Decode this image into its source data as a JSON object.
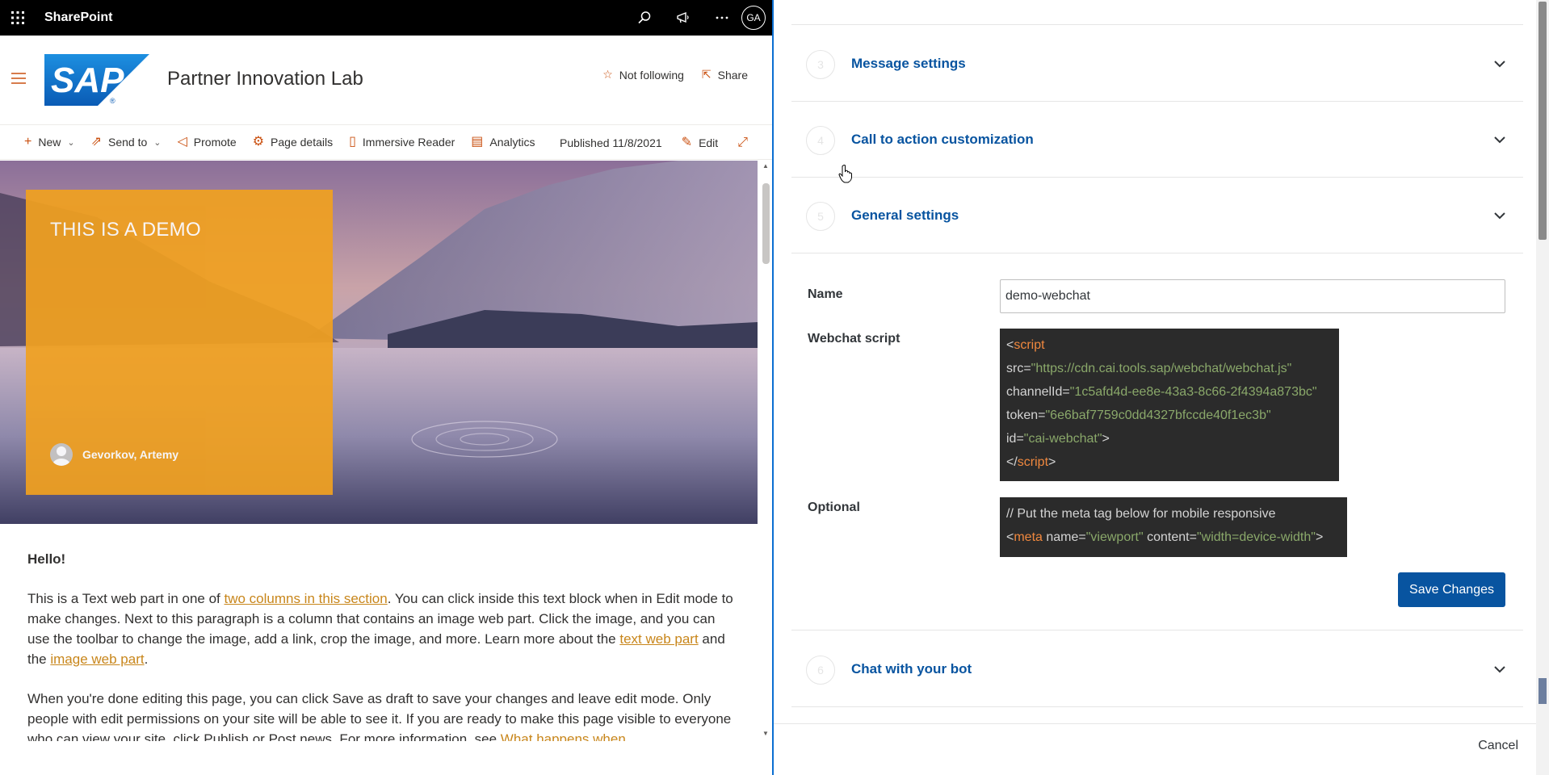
{
  "suitebar": {
    "app_name": "SharePoint",
    "user_initials": "GA"
  },
  "site": {
    "title": "Partner Innovation Lab",
    "follow_label": "Not following",
    "share_label": "Share"
  },
  "commandbar": {
    "new": "New",
    "send_to": "Send to",
    "promote": "Promote",
    "page_details": "Page details",
    "immersive_reader": "Immersive Reader",
    "analytics": "Analytics",
    "published": "Published 11/8/2021",
    "edit": "Edit"
  },
  "hero": {
    "title": "THIS IS A DEMO",
    "author": "Gevorkov, Artemy"
  },
  "article": {
    "heading": "Hello!",
    "p1_a": "This is a Text web part in one of ",
    "p1_link1": "two columns in this section",
    "p1_b": ". You can click inside this text block when in Edit mode to make changes. Next to this paragraph is a column that contains an image web part. Click the image, and you can use the toolbar to change the image, add a link, crop the image, and more. Learn more about the ",
    "p1_link2": "text web part",
    "p1_c": " and the ",
    "p1_link3": "image web part",
    "p1_d": ".",
    "p2_a": "When you're done editing this page, you can click Save as draft to save your changes and leave edit mode. Only people with edit permissions on your site will be able to see it. If you are ready to make this page visible to everyone who can view your site, click Publish or Post news. For more information, see ",
    "p2_link": "What happens when"
  },
  "panel": {
    "steps": [
      {
        "number": "3",
        "label": "Message settings"
      },
      {
        "number": "4",
        "label": "Call to action customization"
      },
      {
        "number": "5",
        "label": "General settings"
      },
      {
        "number": "6",
        "label": "Chat with your bot"
      }
    ],
    "form": {
      "name_label": "Name",
      "name_value": "demo-webchat",
      "script_label": "Webchat script",
      "script": {
        "open_lt": "<",
        "open_tag": "script",
        "src_attr": "src=",
        "src_val": "\"https://cdn.cai.tools.sap/webchat/webchat.js\"",
        "channel_attr": "channelId=",
        "channel_val": "\"1c5afd4d-ee8e-43a3-8c66-2f4394a873bc\"",
        "token_attr": "token=",
        "token_val": "\"6e6baf7759c0dd4327bfccde40f1ec3b\"",
        "id_attr": "id=",
        "id_val": "\"cai-webchat\"",
        "gt": ">",
        "close_lt": "</",
        "close_tag": "script",
        "close_gt": ">"
      },
      "optional_label": "Optional",
      "optional": {
        "comment": "// Put the meta tag below for mobile responsive",
        "lt": "<",
        "tag": "meta",
        "name_attr": " name=",
        "name_val": "\"viewport\"",
        "content_attr": " content=",
        "content_val": "\"width=device-width\"",
        "gt": ">"
      },
      "save_label": "Save Changes"
    },
    "cancel_label": "Cancel"
  },
  "colors": {
    "sap_blue": "#0854a0",
    "hero_card": "#f0a020",
    "link": "#c8861b"
  }
}
